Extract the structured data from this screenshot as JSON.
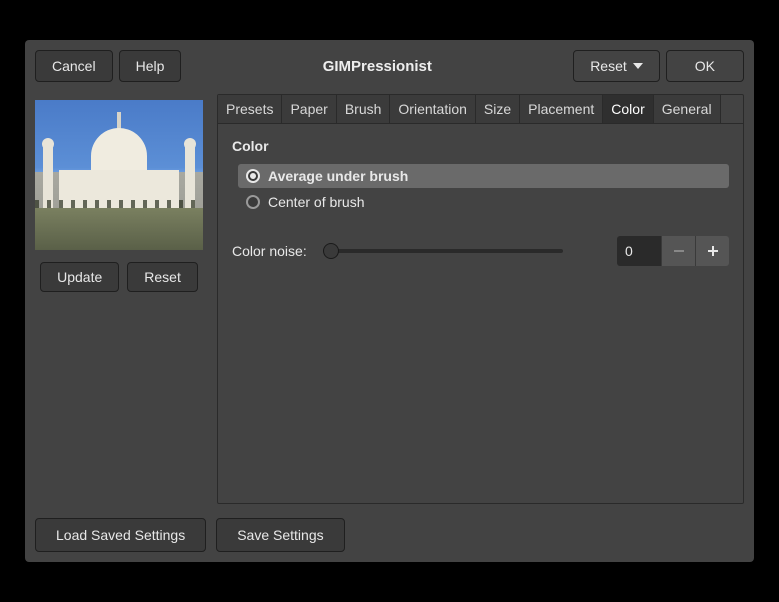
{
  "titlebar": {
    "cancel": "Cancel",
    "help": "Help",
    "title": "GIMPressionist",
    "reset": "Reset",
    "ok": "OK"
  },
  "preview": {
    "update": "Update",
    "reset": "Reset"
  },
  "tabs": [
    {
      "id": "presets",
      "label": "Presets",
      "active": false
    },
    {
      "id": "paper",
      "label": "Paper",
      "active": false
    },
    {
      "id": "brush",
      "label": "Brush",
      "active": false
    },
    {
      "id": "orientation",
      "label": "Orientation",
      "active": false
    },
    {
      "id": "size",
      "label": "Size",
      "active": false
    },
    {
      "id": "placement",
      "label": "Placement",
      "active": false
    },
    {
      "id": "color",
      "label": "Color",
      "active": true
    },
    {
      "id": "general",
      "label": "General",
      "active": false
    }
  ],
  "color_panel": {
    "section_title": "Color",
    "options": {
      "average": "Average under brush",
      "center": "Center of brush",
      "selected": "average"
    },
    "noise_label": "Color noise:",
    "noise_value": "0"
  },
  "footer": {
    "load": "Load Saved Settings",
    "save": "Save Settings"
  }
}
